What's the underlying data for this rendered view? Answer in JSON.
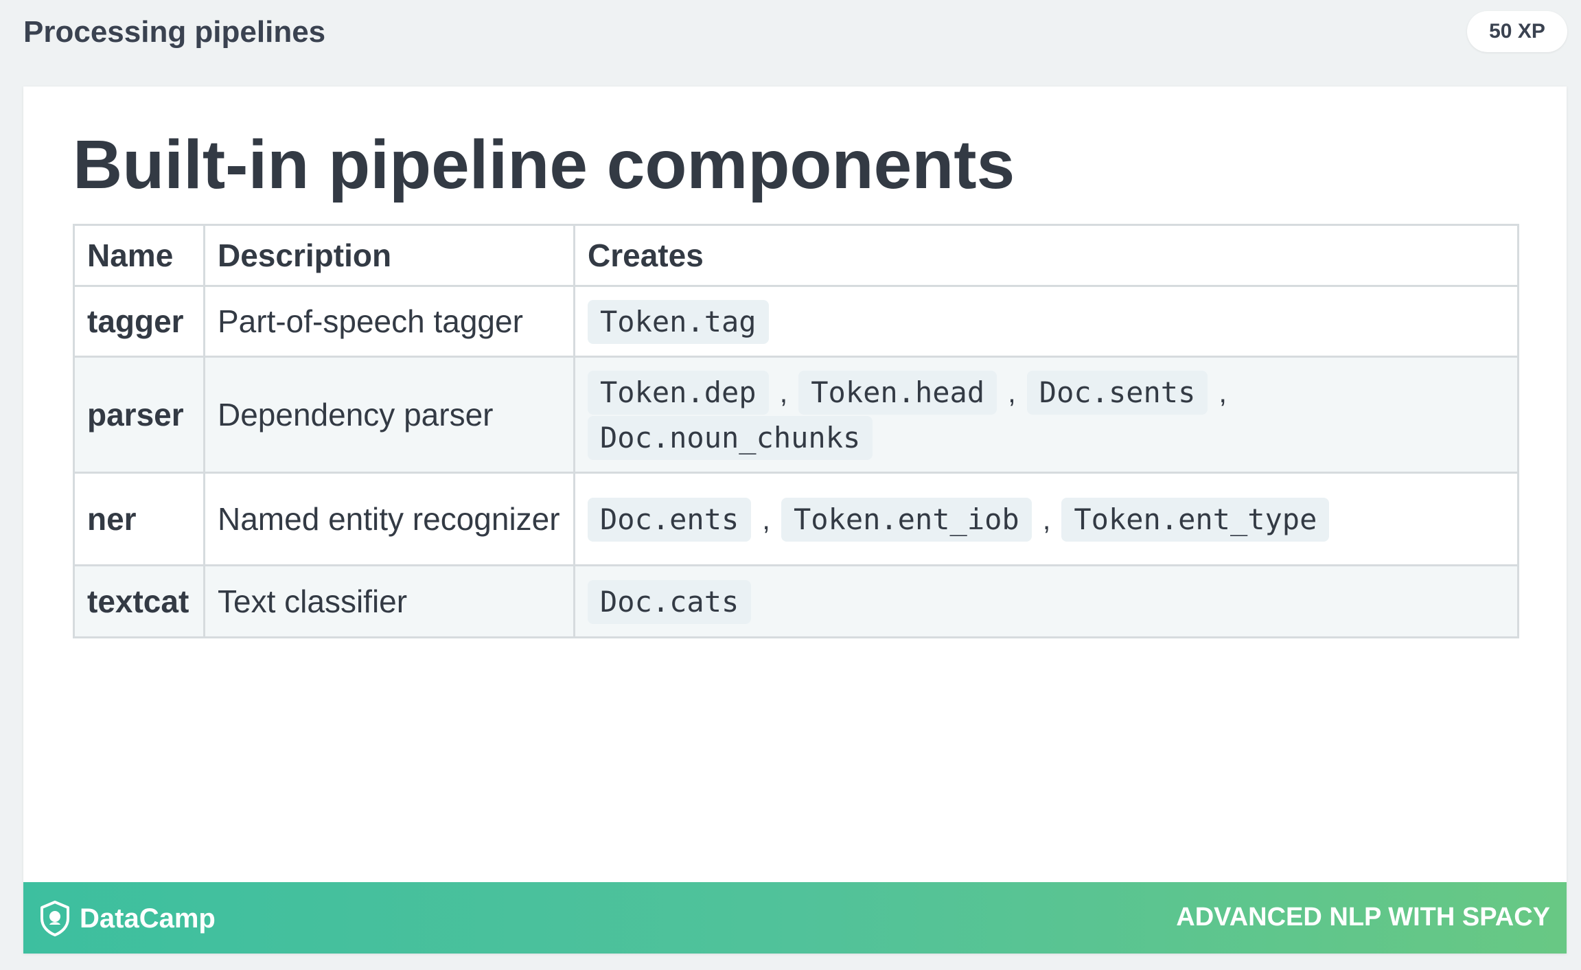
{
  "header": {
    "title": "Processing pipelines",
    "xp_badge": "50 XP"
  },
  "slide": {
    "title": "Built-in pipeline components",
    "table": {
      "headers": [
        "Name",
        "Description",
        "Creates"
      ],
      "rows": [
        {
          "name": "tagger",
          "description": "Part-of-speech tagger",
          "creates": [
            "Token.tag"
          ]
        },
        {
          "name": "parser",
          "description": "Dependency parser",
          "creates": [
            "Token.dep",
            "Token.head",
            "Doc.sents",
            "Doc.noun_chunks"
          ]
        },
        {
          "name": "ner",
          "description": "Named entity recognizer",
          "creates": [
            "Doc.ents",
            "Token.ent_iob",
            "Token.ent_type"
          ]
        },
        {
          "name": "textcat",
          "description": "Text classifier",
          "creates": [
            "Doc.cats"
          ]
        }
      ],
      "separator": ","
    }
  },
  "footer": {
    "brand": "DataCamp",
    "course": "ADVANCED NLP WITH SPACY",
    "brand_icon": "datacamp-shield-icon"
  },
  "colors": {
    "page_background": "#eff2f3",
    "text": "#333a44",
    "code_background": "#eaf1f4",
    "footer_start": "#3dbf9f",
    "footer_end": "#68c884"
  }
}
